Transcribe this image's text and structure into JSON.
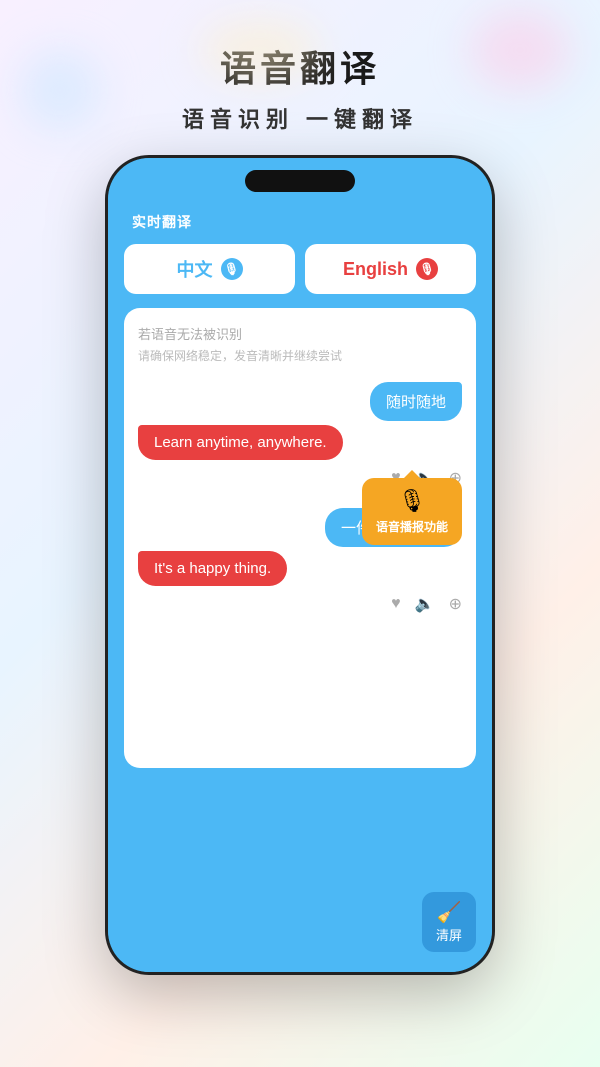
{
  "page": {
    "background": "linear-gradient(135deg, #f8f0ff, #e8f4ff, #fff0e8, #e8fff0)"
  },
  "header": {
    "main_title": "语音翻译",
    "sub_title": "语音识别 一键翻译"
  },
  "app": {
    "title": "实时翻译",
    "lang_btn_left": "中文",
    "lang_btn_right": "English",
    "error_line1": "若语音无法被识别",
    "error_line2": "请确保网络稳定，发音清晰并继续尝试",
    "bubble1_right": "随时随地",
    "bubble1_left": "Learn anytime, anywhere.",
    "bubble2_right": "一件快乐的事。",
    "bubble2_left": "It's a happy thing.",
    "tooltip_text": "语音播报功能",
    "clear_text": "清屏"
  }
}
